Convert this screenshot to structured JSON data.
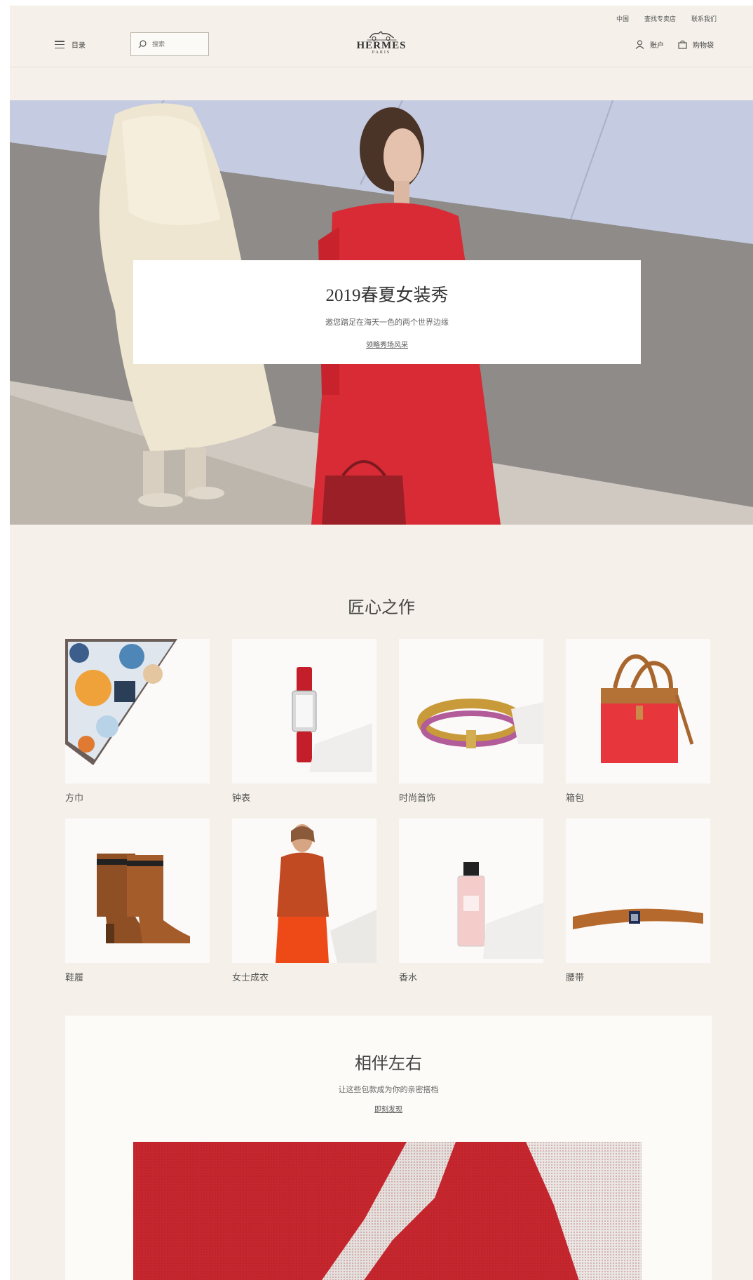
{
  "topbar": {
    "region": "中国",
    "find_store": "查找专卖店",
    "contact": "联系我们"
  },
  "header": {
    "menu_label": "目录",
    "search_placeholder": "搜索",
    "logo_brand": "HERMES",
    "logo_city": "PARIS",
    "account_label": "账户",
    "cart_label": "购物袋"
  },
  "hero": {
    "title": "2019春夏女装秀",
    "subtitle": "邀您踏足在海天一色的两个世界边缘",
    "link": "领略秀场风采"
  },
  "craft": {
    "title": "匠心之作",
    "items": [
      {
        "label": "方巾"
      },
      {
        "label": "钟表"
      },
      {
        "label": "时尚首饰"
      },
      {
        "label": "箱包"
      },
      {
        "label": "鞋履"
      },
      {
        "label": "女士成衣"
      },
      {
        "label": "香水"
      },
      {
        "label": "腰带"
      }
    ]
  },
  "together": {
    "title": "相伴左右",
    "subtitle": "让这些包款成为你的亲密搭档",
    "link": "即刻发现"
  },
  "colors": {
    "page_bg": "#f5f1ea",
    "accent_red": "#d92b35",
    "text": "#333333"
  }
}
